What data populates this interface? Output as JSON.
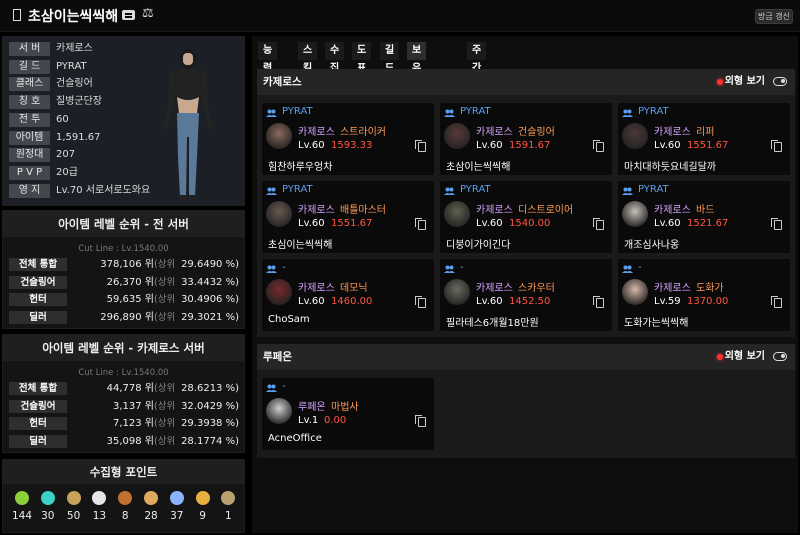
{
  "header": {
    "title": "초삼이는씩씩해",
    "bookmark_icon": "bookmark-icon",
    "card_icon": "id-card-icon",
    "scale_icon": "balance-scale-icon",
    "refresh_label": "방금 갱신"
  },
  "profile": {
    "rows": [
      {
        "label": "서 버",
        "value": "카제로스"
      },
      {
        "label": "길 드",
        "value": "PYRAT"
      },
      {
        "label": "클래스",
        "value": "건슬링어"
      },
      {
        "label": "칭 호",
        "value": "질병군단장"
      },
      {
        "label": "전 투",
        "value": "60"
      },
      {
        "label": "아이템",
        "value": "1,591.67"
      },
      {
        "label": "원정대",
        "value": "207"
      },
      {
        "label": "P V P",
        "value": "20급"
      },
      {
        "label": "영 지",
        "value": "Lv.70 서로서로도와요"
      }
    ]
  },
  "rank_all": {
    "title": "아이템 레벨 순위 - 전 서버",
    "cutline": "Cut Line : Lv.1540.00",
    "rows": [
      {
        "label": "전체 통합",
        "num": "378,106 위",
        "up": "(상위",
        "pct": "29.6490 %)"
      },
      {
        "label": "건슬링어",
        "num": "26,370 위",
        "up": "(상위",
        "pct": "33.4432 %)"
      },
      {
        "label": "헌터",
        "num": "59,635 위",
        "up": "(상위",
        "pct": "30.4906 %)"
      },
      {
        "label": "딜러",
        "num": "296,890 위",
        "up": "(상위",
        "pct": "29.3021 %)"
      }
    ]
  },
  "rank_server": {
    "title": "아이템 레벨 순위 - 카제로스 서버",
    "cutline": "Cut Line : Lv.1540.00",
    "rows": [
      {
        "label": "전체 통합",
        "num": "44,778 위",
        "up": "(상위",
        "pct": "28.6213 %)"
      },
      {
        "label": "건슬링어",
        "num": "3,137 위",
        "up": "(상위",
        "pct": "32.0429 %)"
      },
      {
        "label": "헌터",
        "num": "7,123 위",
        "up": "(상위",
        "pct": "29.3938 %)"
      },
      {
        "label": "딜러",
        "num": "35,098 위",
        "up": "(상위",
        "pct": "28.1774 %)"
      }
    ]
  },
  "collect": {
    "title": "수집형 포인트",
    "items": [
      {
        "icon": "mokoko-seed-icon",
        "color": "#8ccf3a",
        "count": "144"
      },
      {
        "icon": "island-heart-icon",
        "color": "#3fd0c8",
        "count": "30"
      },
      {
        "icon": "great-art-icon",
        "color": "#c9a25a",
        "count": "50"
      },
      {
        "icon": "giant-heart-icon",
        "color": "#e6e6e6",
        "count": "13"
      },
      {
        "icon": "ignea-token-icon",
        "color": "#c07030",
        "count": "8"
      },
      {
        "icon": "voyage-icon",
        "color": "#e0a860",
        "count": "28"
      },
      {
        "icon": "world-tree-leaf-icon",
        "color": "#8ab4ff",
        "count": "37"
      },
      {
        "icon": "orpheus-star-icon",
        "color": "#e8b040",
        "count": "9"
      },
      {
        "icon": "sea-bounty-icon",
        "color": "#b8a070",
        "count": "1"
      }
    ]
  },
  "tabs": [
    {
      "label": "능력치",
      "active": false
    },
    {
      "label": "스킬",
      "active": false
    },
    {
      "label": "수집",
      "active": false
    },
    {
      "label": "도표",
      "active": false
    },
    {
      "label": "길드",
      "active": false
    },
    {
      "label": "보유 캐릭터",
      "active": true
    },
    {
      "label": "주간골드획득",
      "active": false
    }
  ],
  "servers": [
    {
      "name": "카제로스",
      "look_label": "외형 보기",
      "characters": [
        {
          "guild": "PYRAT",
          "server": "카제로스",
          "class": "스트라이커",
          "level": "Lv.60",
          "ilvl": "1593.33",
          "name": "힘찬하루우엉차",
          "avatar_color": "#8a6a5a"
        },
        {
          "guild": "PYRAT",
          "server": "카제로스",
          "class": "건슬링어",
          "level": "Lv.60",
          "ilvl": "1591.67",
          "name": "초삼이는씩씩해",
          "avatar_color": "#5a3a3a"
        },
        {
          "guild": "PYRAT",
          "server": "카제로스",
          "class": "리퍼",
          "level": "Lv.60",
          "ilvl": "1551.67",
          "name": "마치대하듯요네길달까",
          "avatar_color": "#4a3a38"
        },
        {
          "guild": "PYRAT",
          "server": "카제로스",
          "class": "배틀마스터",
          "level": "Lv.60",
          "ilvl": "1551.67",
          "name": "초심이는씩씩해",
          "avatar_color": "#6a5a50"
        },
        {
          "guild": "PYRAT",
          "server": "카제로스",
          "class": "디스트로이어",
          "level": "Lv.60",
          "ilvl": "1540.00",
          "name": "디붕이가이긴다",
          "avatar_color": "#606050"
        },
        {
          "guild": "PYRAT",
          "server": "카제로스",
          "class": "바드",
          "level": "Lv.60",
          "ilvl": "1521.67",
          "name": "개조심사나옹",
          "avatar_color": "#c8c0b8"
        },
        {
          "guild": "-",
          "server": "카제로스",
          "class": "데모닉",
          "level": "Lv.60",
          "ilvl": "1460.00",
          "name": "ChoSam",
          "avatar_color": "#7a2a2a"
        },
        {
          "guild": "-",
          "server": "카제로스",
          "class": "스카우터",
          "level": "Lv.60",
          "ilvl": "1452.50",
          "name": "필라테스6개월18만원",
          "avatar_color": "#6a6a60"
        },
        {
          "guild": "-",
          "server": "카제로스",
          "class": "도화가",
          "level": "Lv.59",
          "ilvl": "1370.00",
          "name": "도화가는씩씩해",
          "avatar_color": "#d8b8a8"
        }
      ]
    },
    {
      "name": "루페온",
      "look_label": "외형 보기",
      "characters": [
        {
          "guild": "-",
          "server": "루페온",
          "class": "마법사",
          "level": "Lv.1",
          "ilvl": "0.00",
          "name": "AcneOffice",
          "avatar_color": "#cfcfcf"
        }
      ]
    }
  ]
}
